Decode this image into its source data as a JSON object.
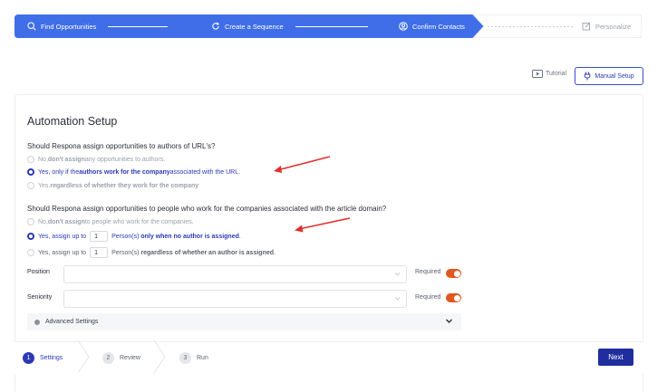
{
  "progress": {
    "steps": [
      {
        "label": "Find Opportunities",
        "icon": "search-icon"
      },
      {
        "label": "Create a Sequence",
        "icon": "refresh-icon"
      },
      {
        "label": "Confirm Contacts",
        "icon": "user-icon"
      },
      {
        "label": "Personalize",
        "icon": "edit-icon"
      }
    ],
    "accent": "#3f6ee8"
  },
  "toolbar": {
    "tutorial_label": "Tutorial",
    "manual_setup_label": "Manual Setup"
  },
  "automation": {
    "title": "Automation Setup",
    "q1": {
      "question": "Should Respona assign opportunities to authors of URL's?",
      "options": [
        {
          "pre": "No, ",
          "bold": "don't assign",
          "post": " any opportunities to authors."
        },
        {
          "pre": "Yes, only if the ",
          "bold": "authors work for the company",
          "post": " associated with the URL."
        },
        {
          "pre": "Yes, ",
          "bold": "regardless of whether they work for the company",
          "post": ""
        }
      ],
      "selected": 1
    },
    "q2": {
      "question": "Should Respona assign opportunities to people who work for the companies associated with the article domain?",
      "opt1": {
        "pre": "No, ",
        "bold": "don't assign",
        "post": " to people who work for the companies."
      },
      "opt2": {
        "pre": "Yes, assign up to",
        "value": "1",
        "mid": "Person(s) ",
        "bold": "only when no author is assigned",
        "post": "."
      },
      "opt3": {
        "pre": "Yes, assign up to",
        "value": "1",
        "mid": "Person(s) ",
        "bold": "regardless of whether an author is assigned",
        "post": "."
      },
      "selected": 1
    },
    "fields": {
      "position_label": "Position",
      "seniority_label": "Seniority",
      "required_label": "Required"
    },
    "advanced_label": "Advanced Settings"
  },
  "wizard": {
    "steps": [
      {
        "num": "1",
        "label": "Settings"
      },
      {
        "num": "2",
        "label": "Review"
      },
      {
        "num": "3",
        "label": "Run"
      }
    ],
    "next_label": "Next"
  },
  "colors": {
    "primary": "#2c3ab5",
    "toggle_on": "#e2561f",
    "annotation_arrow": "#e0312b"
  }
}
